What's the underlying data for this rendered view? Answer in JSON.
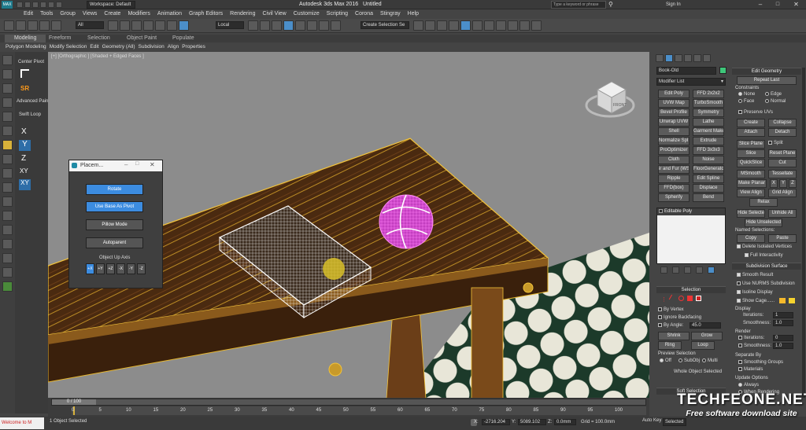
{
  "window": {
    "app_logo": "MAX",
    "workspace_label": "Workspace: Default",
    "title": "Autodesk 3ds Max 2016",
    "doc": "Untitled",
    "search_placeholder": "Type a keyword or phrase",
    "sign_in": "Sign In"
  },
  "menu": [
    "Edit",
    "Tools",
    "Group",
    "Views",
    "Create",
    "Modifiers",
    "Animation",
    "Graph Editors",
    "Rendering",
    "Civil View",
    "Customize",
    "Scripting",
    "Corona",
    "Stingray",
    "Help"
  ],
  "main_toolbar": {
    "selection_filter": "All",
    "ref_coord": "Local",
    "named_selection": "Create Selection Se"
  },
  "ribbon": {
    "tabs": [
      "Modeling",
      "Freeform",
      "Selection",
      "Object Paint",
      "Populate"
    ],
    "subtabs": [
      "Polygon Modeling",
      "Modify Selection",
      "Edit",
      "Geometry (All)",
      "Subdivision",
      "Align",
      "Properties"
    ]
  },
  "palette": {
    "items": [
      "Center Pivot",
      "SR",
      "Advanced Paint",
      "Swift Loop"
    ],
    "axes": [
      "X",
      "Y",
      "Z",
      "XY",
      "XY"
    ]
  },
  "viewport": {
    "label": "[+] [Orthographic ] [Shaded + Edged Faces ]",
    "viewcube_label": "FRONT"
  },
  "placement": {
    "title": "Placem...",
    "buttons": [
      "Rotate",
      "Use Base As Pivot",
      "Pillow Mode",
      "Autoparent"
    ],
    "axis_label": "Object Up Axis",
    "axes": [
      "+X",
      "+Y",
      "+Z",
      "-X",
      "-Y",
      "-Z"
    ]
  },
  "command_panel": {
    "object_name": "Book-Old",
    "object_color": "#3ec77a",
    "modifier_list": "Modifier List",
    "modifier_buttons": [
      [
        "Edit Poly",
        "FFD 2x2x2"
      ],
      [
        "UVW Map",
        "TurboSmooth"
      ],
      [
        "Bevel Profile",
        "Symmetry"
      ],
      [
        "Unwrap UVW",
        "Lathe"
      ],
      [
        "Shell",
        "Garment Maker"
      ],
      [
        "Normalize Spl.",
        "Extrude"
      ],
      [
        "ProOptimizer",
        "FFD 3x3x3"
      ],
      [
        "Cloth",
        "Noise"
      ],
      [
        "ir and Fur (WS",
        "FloorGenerator"
      ],
      [
        "Ripple",
        "Edit Spline"
      ],
      [
        "FFD(box)",
        "Displace"
      ],
      [
        "Spherify",
        "Bend"
      ]
    ],
    "stack_item": "Editable Poly",
    "selection": {
      "header": "Selection",
      "by_vertex": "By Vertex",
      "ignore_backfacing": "Ignore Backfacing",
      "by_angle": "By Angle:",
      "angle_value": "45.0",
      "shrink": "Shrink",
      "grow": "Grow",
      "ring": "Ring",
      "loop": "Loop",
      "preview_label": "Preview Selection",
      "preview_opts": [
        "Off",
        "SubObj",
        "Multi"
      ],
      "status": "Whole Object Selected",
      "soft_selection": "Soft Selection"
    }
  },
  "edit_geometry": {
    "header": "Edit Geometry",
    "repeat_last": "Repeat Last",
    "constraints": "Constraints",
    "constraint_opts": [
      "None",
      "Edge",
      "Face",
      "Normal"
    ],
    "preserve_uvs": "Preserve UVs",
    "create": "Create",
    "collapse": "Collapse",
    "attach": "Attach",
    "detach": "Detach",
    "slice_plane": "Slice Plane",
    "split": "Split",
    "slice": "Slice",
    "reset_plane": "Reset Plane",
    "quickslice": "QuickSlice",
    "cut": "Cut",
    "msmooth": "MSmooth",
    "tessellate": "Tessellate",
    "make_planar": "Make Planar",
    "x": "X",
    "y": "Y",
    "z": "Z",
    "view_align": "View Align",
    "grid_align": "Grid Align",
    "relax": "Relax",
    "hide_selected": "Hide Selected",
    "unhide_all": "Unhide All",
    "hide_unselected": "Hide Unselected",
    "named_selections": "Named Selections:",
    "copy": "Copy",
    "paste": "Paste",
    "delete_isolated": "Delete Isolated Vertices",
    "full_interactivity": "Full Interactivity"
  },
  "subdivision": {
    "header": "Subdivision Surface",
    "smooth_result": "Smooth Result",
    "use_nurms": "Use NURMS Subdivision",
    "isoline": "Isoline Display",
    "show_cage": "Show Cage......",
    "display": "Display",
    "iterations": "Iterations:",
    "iterations_val": "1",
    "smoothness": "Smoothness:",
    "smoothness_val": "1.0",
    "render": "Render",
    "r_iterations": "Iterations:",
    "r_iterations_val": "0",
    "r_smoothness": "Smoothness:",
    "r_smoothness_val": "1.0",
    "separate_by": "Separate By",
    "smoothing_groups": "Smoothing Groups",
    "materials": "Materials",
    "update_options": "Update Options",
    "always": "Always",
    "when_rendering": "When Rendering"
  },
  "timeline": {
    "frame": "0 / 100",
    "ticks": [
      "0",
      "5",
      "10",
      "15",
      "20",
      "25",
      "30",
      "35",
      "40",
      "45",
      "50",
      "55",
      "60",
      "65",
      "70",
      "75",
      "80",
      "85",
      "90",
      "95",
      "100"
    ]
  },
  "status": {
    "script_box": "Welcome to M",
    "selected": "1 Object Selected",
    "x_label": "X:",
    "x_val": "-2716.204",
    "y_label": "Y:",
    "y_val": "5089.102",
    "z_label": "Z:",
    "z_val": "0.0mm",
    "grid": "Grid = 100.0mm",
    "auto_key": "Auto Key",
    "selected_drop": "Selected"
  },
  "watermark": {
    "brand": "TECHFEONE.NET",
    "tagline": "Free software download site"
  }
}
